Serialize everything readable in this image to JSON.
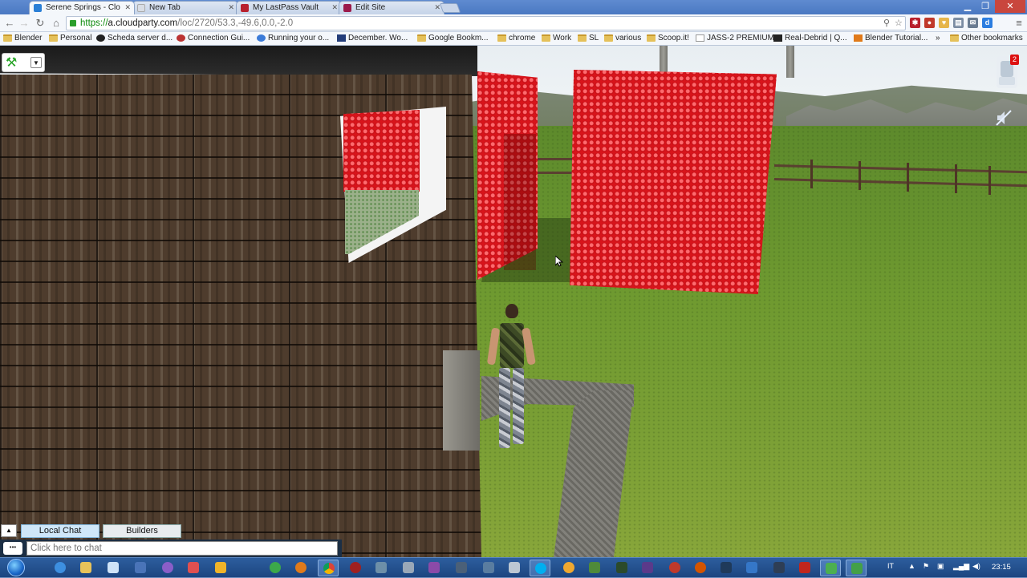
{
  "browser": {
    "tabs": [
      {
        "label": "Serene Springs - Clo",
        "active": true,
        "color": "#2a7fd6"
      },
      {
        "label": "New Tab",
        "active": false,
        "color": "#d8dde5"
      },
      {
        "label": "My LastPass Vault",
        "active": false,
        "color": "#b8202d"
      },
      {
        "label": "Edit Site",
        "active": false,
        "color": "#9b1a4a"
      }
    ],
    "url_scheme": "https://",
    "url_host": "a.cloudparty.com",
    "url_path": "/loc/2720/53.3,-49.6,0.0,-2.0",
    "bookmarks": [
      {
        "label": "Blender",
        "kind": "folder"
      },
      {
        "label": "Personal",
        "kind": "folder"
      },
      {
        "label": "Scheda server d...",
        "kind": "site"
      },
      {
        "label": "Connection Gui...",
        "kind": "site"
      },
      {
        "label": "Running your o...",
        "kind": "site"
      },
      {
        "label": "December. Wo...",
        "kind": "site"
      },
      {
        "label": "Google Bookm...",
        "kind": "folder"
      },
      {
        "label": "chrome",
        "kind": "folder"
      },
      {
        "label": "Work",
        "kind": "folder"
      },
      {
        "label": "SL",
        "kind": "folder"
      },
      {
        "label": "various",
        "kind": "folder"
      },
      {
        "label": "Scoop.it!",
        "kind": "folder"
      },
      {
        "label": "JASS-2 PREMIUM",
        "kind": "site"
      },
      {
        "label": "Real-Debrid | Q...",
        "kind": "site"
      },
      {
        "label": "Blender Tutorial...",
        "kind": "site"
      }
    ],
    "more_bookmarks": "»",
    "other_bookmarks": "Other bookmarks"
  },
  "app": {
    "notification_count": "2",
    "chat": {
      "tabs": [
        "Local Chat",
        "Builders"
      ],
      "active_tab": "Local Chat",
      "input_placeholder": "Click here to chat"
    }
  },
  "taskbar": {
    "language": "IT",
    "clock": "23:15"
  },
  "colors": {
    "red_wall": "#d8141b",
    "grass": "#6f9a30",
    "taskbar": "#1c4580"
  }
}
